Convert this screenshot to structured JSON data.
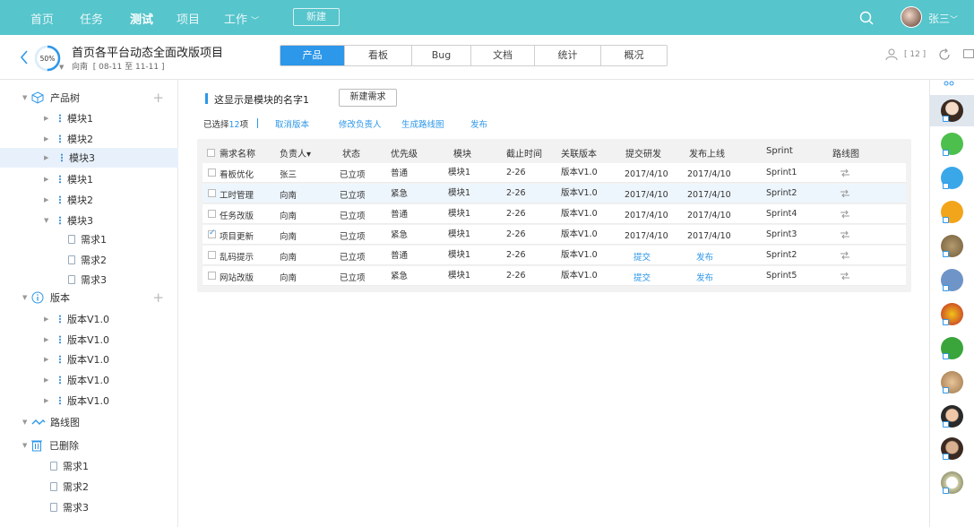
{
  "topnav": {
    "items": [
      "首页",
      "任务",
      "测试",
      "项目",
      "工作"
    ],
    "active": "测试",
    "new_label": "新建",
    "user": "张三"
  },
  "project": {
    "progress": "50%",
    "title": "首页各平台动态全面改版项目",
    "owner": "向南",
    "range": "[ 08-11 至 11-11 ]",
    "members": "[ 12 ]",
    "tabs": [
      "产品",
      "看板",
      "Bug",
      "文档",
      "统计",
      "概况"
    ],
    "active_tab": "产品"
  },
  "sidebar": {
    "product_tree": "产品树",
    "modules_a": [
      "模块1",
      "模块2",
      "模块3"
    ],
    "modules_b": [
      "模块1",
      "模块2",
      "模块3"
    ],
    "reqs_a": [
      "需求1",
      "需求2",
      "需求3"
    ],
    "version": "版本",
    "versions": [
      "版本V1.0",
      "版本V1.0",
      "版本V1.0",
      "版本V1.0",
      "版本V1.0"
    ],
    "roadmap": "路线图",
    "deleted": "已删除",
    "reqs_b": [
      "需求1",
      "需求2",
      "需求3"
    ]
  },
  "main": {
    "section_title": "这显示是模块的名字1",
    "new_req": "新建需求",
    "selected_prefix": "已选择",
    "selected_count": "12",
    "selected_suffix": "项",
    "actions": [
      "取消版本",
      "修改负责人",
      "生成路线图",
      "发布"
    ],
    "columns": [
      "需求名称",
      "负责人▾",
      "状态",
      "优先级",
      "模块",
      "截止时间",
      "关联版本",
      "提交研发",
      "发布上线",
      "Sprint",
      "路线图"
    ],
    "rows": [
      {
        "name": "看板优化",
        "owner": "张三",
        "status": "已立项",
        "priority": "普通",
        "module": "模块1",
        "due": "2-26",
        "version": "版本V1.0",
        "submit": "2017/4/10",
        "release": "2017/4/10",
        "sprint": "Sprint1",
        "checked": false
      },
      {
        "name": "工时管理",
        "owner": "向南",
        "status": "已立项",
        "priority": "紧急",
        "module": "模块1",
        "due": "2-26",
        "version": "版本V1.0",
        "submit": "2017/4/10",
        "release": "2017/4/10",
        "sprint": "Sprint2",
        "checked": false
      },
      {
        "name": "任务改版",
        "owner": "向南",
        "status": "已立项",
        "priority": "普通",
        "module": "模块1",
        "due": "2-26",
        "version": "版本V1.0",
        "submit": "2017/4/10",
        "release": "2017/4/10",
        "sprint": "Sprint4",
        "checked": false
      },
      {
        "name": "项目更新",
        "owner": "向南",
        "status": "已立项",
        "priority": "紧急",
        "module": "模块1",
        "due": "2-26",
        "version": "版本V1.0",
        "submit": "2017/4/10",
        "release": "2017/4/10",
        "sprint": "Sprint3",
        "checked": true
      },
      {
        "name": "乱码提示",
        "owner": "向南",
        "status": "已立项",
        "priority": "普通",
        "module": "模块1",
        "due": "2-26",
        "version": "版本V1.0",
        "submit": "提交",
        "release": "发布",
        "sprint": "Sprint2",
        "checked": false
      },
      {
        "name": "网站改版",
        "owner": "向南",
        "status": "已立项",
        "priority": "紧急",
        "module": "模块1",
        "due": "2-26",
        "version": "版本V1.0",
        "submit": "提交",
        "release": "发布",
        "sprint": "Sprint5",
        "checked": false
      }
    ]
  },
  "colors": {
    "topbar": "#56c5cc",
    "accent": "#2d97e9"
  }
}
